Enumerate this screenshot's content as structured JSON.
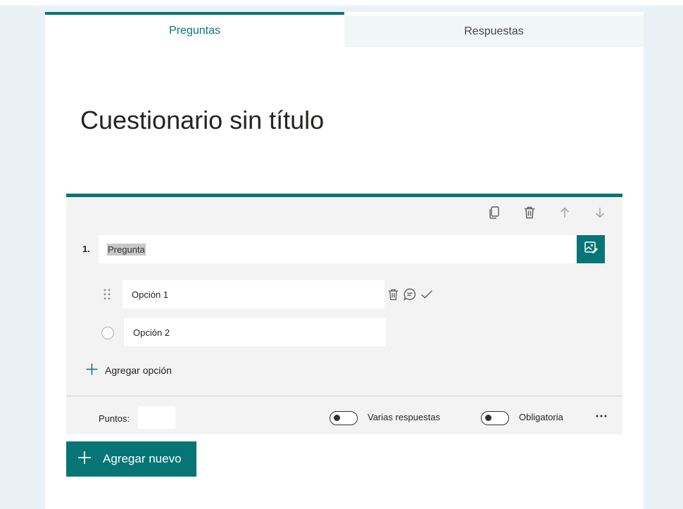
{
  "tabs": [
    {
      "label": "Preguntas",
      "active": true
    },
    {
      "label": "Respuestas",
      "active": false
    }
  ],
  "form": {
    "title": "Cuestionario sin título"
  },
  "question": {
    "number": "1.",
    "text": "Pregunta",
    "toolbar": [
      "copy-icon",
      "trash-icon",
      "arrow-up-icon",
      "arrow-down-icon"
    ],
    "image_button": "image-edit-icon",
    "options": [
      {
        "label": "Opción 1"
      },
      {
        "label": "Opción 2"
      }
    ],
    "add_option_label": "Agregar opción",
    "points_label": "Puntos:",
    "points_value": "",
    "multiple_answers_label": "Varias respuestas",
    "required_label": "Obligatoria"
  },
  "add_new_label": "Agregar nuevo",
  "colors": {
    "accent": "#077575",
    "card_bg": "#f3f3f3",
    "page_bg": "#e9f1f4"
  }
}
